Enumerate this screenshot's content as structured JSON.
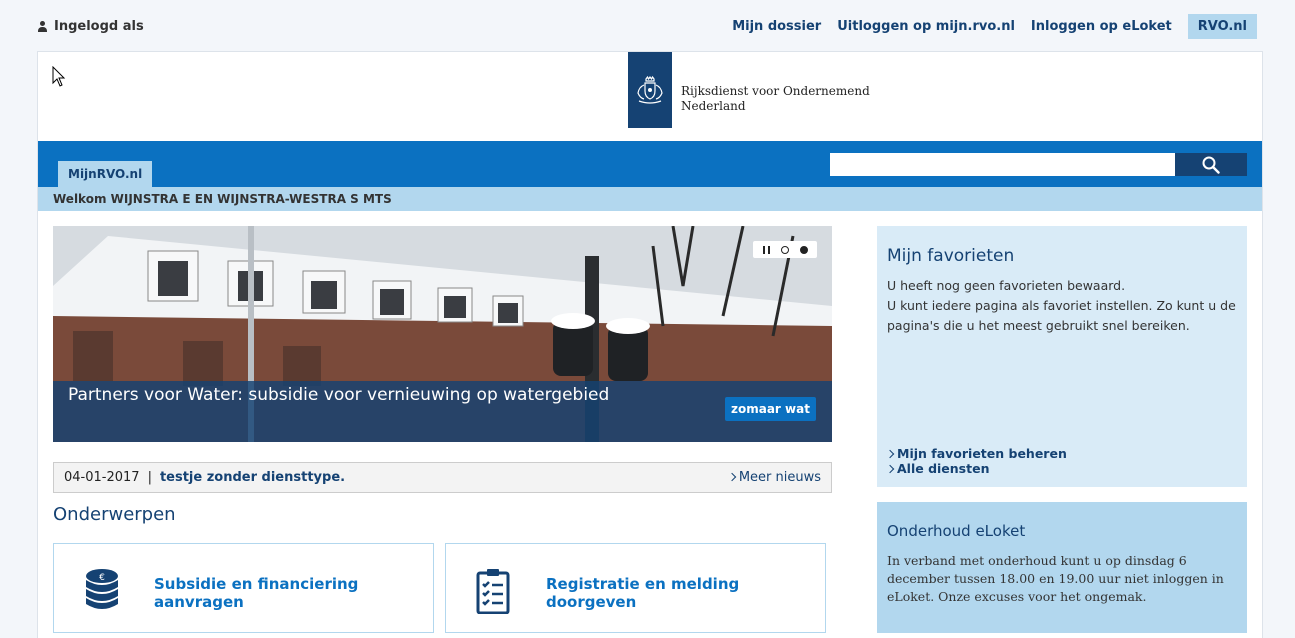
{
  "topbar": {
    "logged_in": "Ingelogd als",
    "links": [
      "Mijn dossier",
      "Uitloggen op mijn.rvo.nl",
      "Inloggen op eLoket",
      "RVO.nl"
    ]
  },
  "logo": {
    "line1": "Rijksdienst voor Ondernemend",
    "line2": "Nederland"
  },
  "nav": {
    "tab": "MijnRVO.nl",
    "search_placeholder": ""
  },
  "welcome": "Welkom WIJNSTRA E EN WIJNSTRA-WESTRA S MTS",
  "hero": {
    "title": "Partners voor Water: subsidie voor vernieuwing op watergebied",
    "button": "zomaar wat"
  },
  "news": {
    "date": "04-01-2017",
    "separator": "|",
    "title": "testje zonder diensttype.",
    "more": "Meer nieuws"
  },
  "section_title": "Onderwerpen",
  "tiles": [
    {
      "label": "Subsidie en financiering aanvragen",
      "icon": "coins-icon"
    },
    {
      "label": "Registratie en melding doorgeven",
      "icon": "clipboard-icon"
    }
  ],
  "favorites": {
    "title": "Mijn favorieten",
    "line1": "U heeft nog geen favorieten bewaard.",
    "line2": "U kunt iedere pagina als favoriet instellen. Zo kunt u de pagina's die u het meest gebruikt snel bereiken.",
    "link1": "Mijn favorieten beheren",
    "link2": "Alle diensten"
  },
  "maintenance": {
    "title": "Onderhoud eLoket",
    "text": "In verband met onderhoud kunt u op dinsdag 6 december tussen 18.00 en 19.00 uur niet inloggen in eLoket. Onze excuses voor het ongemak."
  },
  "colors": {
    "primary_dark": "#154273",
    "primary": "#0b71c1",
    "light": "#b2d7ee",
    "lighter": "#d9ebf7"
  }
}
